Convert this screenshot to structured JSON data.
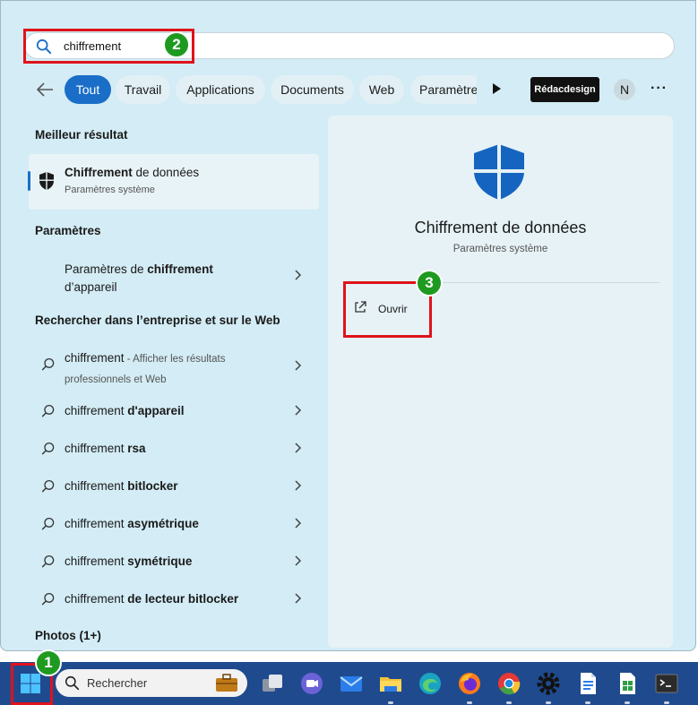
{
  "search": {
    "query": "chiffrement"
  },
  "filters": {
    "tabs": [
      {
        "label": "Tout",
        "active": true
      },
      {
        "label": "Travail",
        "active": false
      },
      {
        "label": "Applications",
        "active": false
      },
      {
        "label": "Documents",
        "active": false
      },
      {
        "label": "Web",
        "active": false
      },
      {
        "label": "Paramètre",
        "active": false
      }
    ],
    "brand": "Rédacdesign",
    "avatar_initial": "N",
    "more": "···"
  },
  "best_match": {
    "heading": "Meilleur résultat",
    "title_bold": "Chiffrement",
    "title_rest": " de données",
    "subtitle": "Paramètres système"
  },
  "settings": {
    "heading": "Paramètres",
    "item_prefix": "Paramètres de ",
    "item_bold": "chiffrement",
    "item_line2": "d’appareil"
  },
  "web": {
    "heading": "Rechercher dans l’entreprise et sur le Web",
    "first": {
      "term": "chiffrement",
      "sep": " - ",
      "hint1": "Afficher les résultats",
      "hint2": "professionnels et Web"
    },
    "items": [
      {
        "base": "chiffrement ",
        "bold": "d'appareil"
      },
      {
        "base": "chiffrement ",
        "bold": "rsa"
      },
      {
        "base": "chiffrement ",
        "bold": "bitlocker"
      },
      {
        "base": "chiffrement ",
        "bold": "asymétrique"
      },
      {
        "base": "chiffrement ",
        "bold": "symétrique"
      },
      {
        "base": "chiffrement ",
        "bold": "de lecteur bitlocker"
      }
    ]
  },
  "photos": {
    "heading": "Photos (1+)"
  },
  "preview": {
    "title": "Chiffrement de données",
    "subtitle": "Paramètres système",
    "open_label": "Ouvrir"
  },
  "taskbar": {
    "search_label": "Rechercher"
  },
  "badges": [
    "1",
    "2",
    "3"
  ],
  "colors": {
    "accent": "#1a6ec7",
    "highlight_box": "#e0121b",
    "badge": "#1f9a20",
    "taskbar": "#1f4a8e"
  }
}
